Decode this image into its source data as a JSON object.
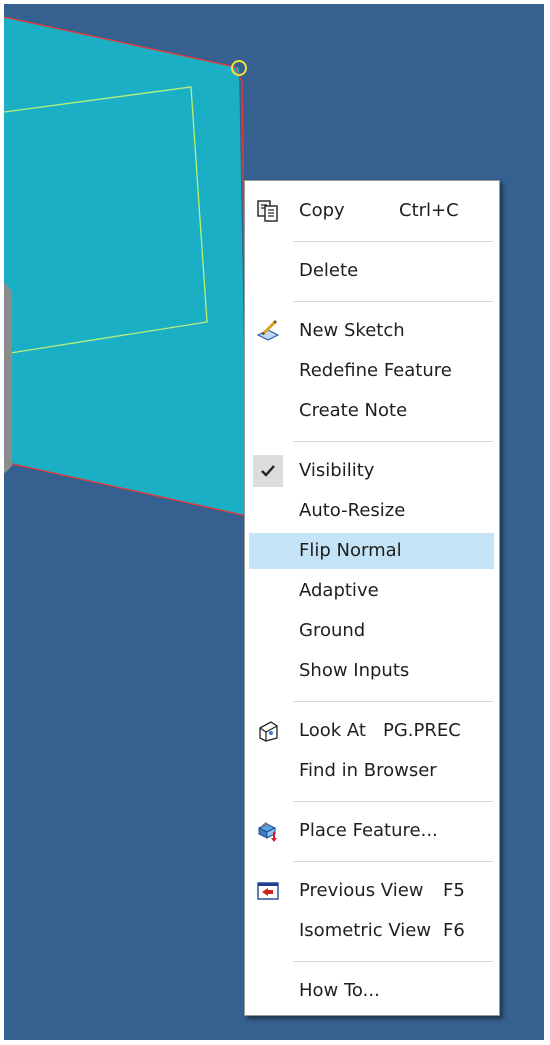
{
  "viewport": {
    "background": "#36608f",
    "face_color": "#1bafc6",
    "edge_color": "#e03c3c",
    "sketch_line_color": "#b9f07a"
  },
  "context_menu": {
    "copy": {
      "label": "Copy",
      "shortcut": "Ctrl+C",
      "icon": "copy-icon"
    },
    "delete": {
      "label": "Delete"
    },
    "new_sketch": {
      "label": "New Sketch",
      "icon": "new-sketch-icon"
    },
    "redefine_feature": {
      "label": "Redefine Feature"
    },
    "create_note": {
      "label": "Create Note"
    },
    "visibility": {
      "label": "Visibility",
      "checked": true
    },
    "auto_resize": {
      "label": "Auto-Resize"
    },
    "flip_normal": {
      "label": "Flip Normal",
      "highlighted": true
    },
    "adaptive": {
      "label": "Adaptive"
    },
    "ground": {
      "label": "Ground"
    },
    "show_inputs": {
      "label": "Show Inputs"
    },
    "look_at": {
      "label": "Look At",
      "shortcut": "PG.PREC",
      "icon": "look-at-icon"
    },
    "find_in_browser": {
      "label": "Find in Browser"
    },
    "place_feature": {
      "label": "Place Feature...",
      "icon": "place-feature-icon"
    },
    "previous_view": {
      "label": "Previous View",
      "shortcut": "F5",
      "icon": "previous-view-icon"
    },
    "isometric_view": {
      "label": "Isometric View",
      "shortcut": "F6"
    },
    "how_to": {
      "label": "How To..."
    }
  }
}
